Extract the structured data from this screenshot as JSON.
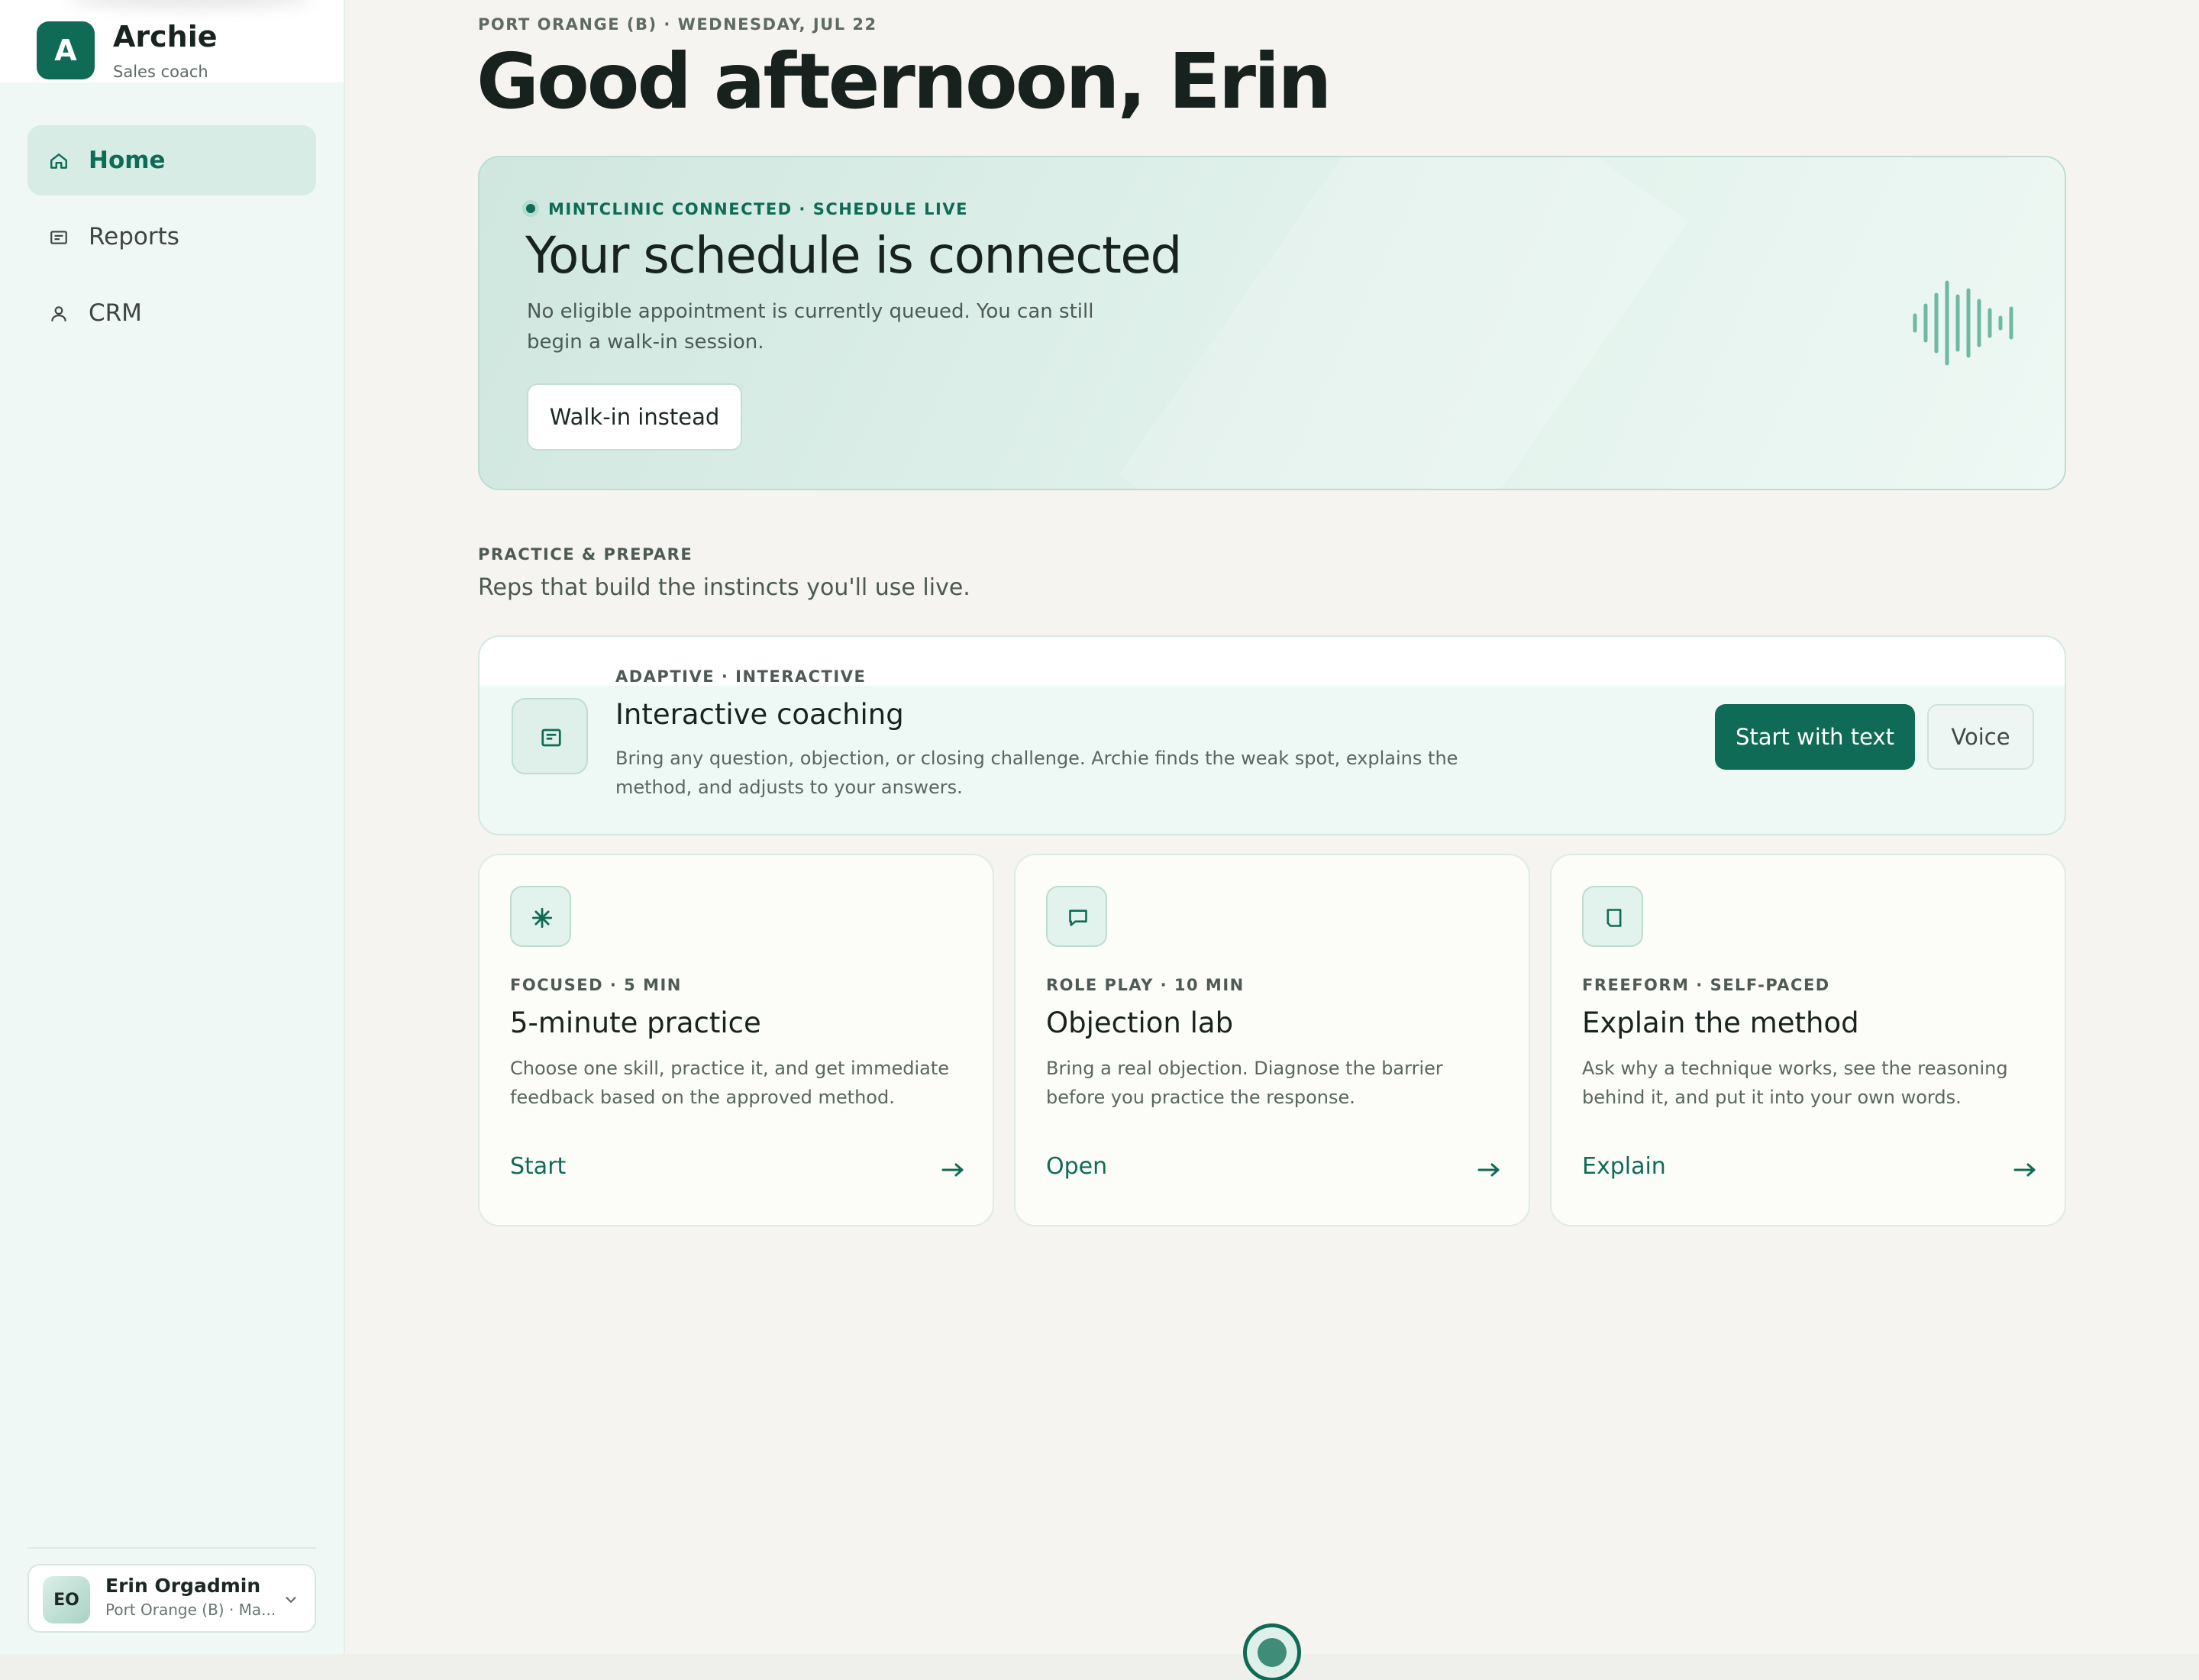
{
  "brand": {
    "logo_letter": "A",
    "name": "Archie",
    "subtitle": "Sales coach"
  },
  "nav": [
    {
      "label": "Home",
      "icon": "home-icon",
      "active": true
    },
    {
      "label": "Reports",
      "icon": "reports-icon",
      "active": false
    },
    {
      "label": "CRM",
      "icon": "person-icon",
      "active": false
    }
  ],
  "user": {
    "initials": "EO",
    "name": "Erin Orgadmin",
    "org": "Port Orange (B) · Ma..."
  },
  "header": {
    "eyebrow": "PORT ORANGE (B) · WEDNESDAY, JUL 22",
    "greeting": "Good afternoon, Erin"
  },
  "hero": {
    "status": "MINTCLINIC CONNECTED · SCHEDULE LIVE",
    "title": "Your schedule is connected",
    "description": "No eligible appointment is currently queued. You can still begin a walk-in session.",
    "button": "Walk-in instead"
  },
  "practice": {
    "eyebrow": "PRACTICE & PREPARE",
    "subtitle": "Reps that build the instincts you'll use live.",
    "featured": {
      "eyebrow": "ADAPTIVE · INTERACTIVE",
      "title": "Interactive coaching",
      "description": "Bring any question, objection, or closing challenge. Archie finds the weak spot, explains the method, and adjusts to your answers.",
      "primary_button": "Start with text",
      "secondary_button": "Voice"
    },
    "tiles": [
      {
        "eyebrow": "FOCUSED · 5 MIN",
        "title": "5-minute practice",
        "description": "Choose one skill, practice it, and get immediate feedback based on the approved method.",
        "action": "Start",
        "icon": "sparkle-icon"
      },
      {
        "eyebrow": "ROLE PLAY · 10 MIN",
        "title": "Objection lab",
        "description": "Bring a real objection. Diagnose the barrier before you practice the response.",
        "action": "Open",
        "icon": "chat-bubble-icon"
      },
      {
        "eyebrow": "FREEFORM · SELF-PACED",
        "title": "Explain the method",
        "description": "Ask why a technique works, see the reasoning behind it, and put it into your own words.",
        "action": "Explain",
        "icon": "square-icon"
      }
    ]
  },
  "colors": {
    "accent": "#0f6b55",
    "sidebar_bg": "#eff8f5",
    "page_bg": "#f5f4f0"
  }
}
